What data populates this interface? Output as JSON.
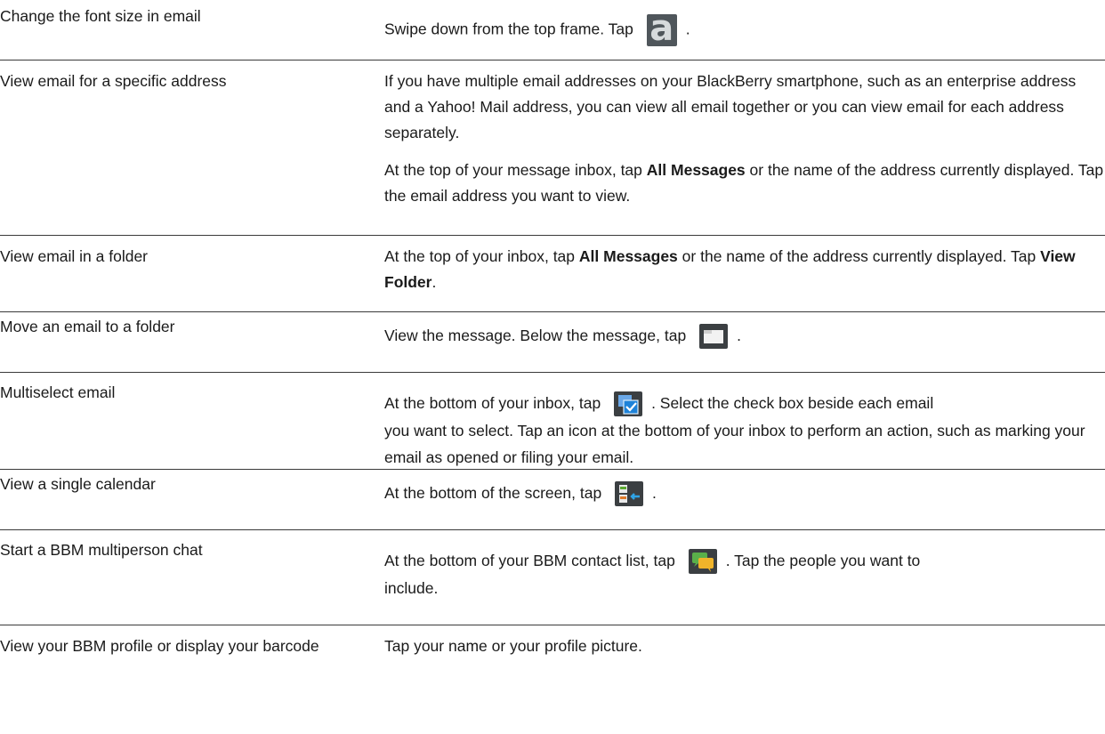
{
  "rows": [
    {
      "task": "Change the font size in email",
      "text_a": "Swipe down from the top frame. Tap",
      "icon": "font-size-icon",
      "icon_glyph": "a",
      "text_b": "."
    },
    {
      "task": "View email for a specific address",
      "para1": "If you have multiple email addresses on your BlackBerry smartphone, such as an enterprise address and a Yahoo! Mail address, you can view all email together or you can view email for each address separately.",
      "para2_a": "At the top of your message inbox, tap",
      "para2_bold": "All Messages",
      "para2_b": "or the name of the address currently displayed. Tap the email address you want to view."
    },
    {
      "task": "View email in a folder",
      "a": "At the top of your inbox, tap",
      "bold1": "All Messages",
      "b": "or the name of the address currently displayed. Tap",
      "bold2": "View Folder",
      "c": "."
    },
    {
      "task": "Move an email to a folder",
      "text_a": "View the message. Below the message, tap",
      "icon": "move-to-folder-icon",
      "text_b": "."
    },
    {
      "task": "Multiselect email",
      "text_a": "At the bottom of your inbox, tap",
      "icon": "multiselect-icon",
      "text_b": ". Select the check box beside each email",
      "text_c": "you want to select. Tap an icon at the bottom of your inbox to perform an action, such as marking your email as opened or filing your email."
    },
    {
      "task": "View a single calendar",
      "text_a": "At the bottom of the screen, tap",
      "icon": "single-calendar-icon",
      "text_b": "."
    },
    {
      "task": "Start a BBM multiperson chat",
      "text_a": "At the bottom of your BBM contact list, tap",
      "icon": "multiperson-chat-icon",
      "text_b": ". Tap the people you want to",
      "text_c": "include."
    },
    {
      "task": "View your BBM profile or display your barcode",
      "text": "Tap your name or your profile picture."
    }
  ],
  "colors": {
    "text": "#1a1a1a",
    "divider": "#3a3a3a",
    "icon_bg": "#3b3f42"
  }
}
